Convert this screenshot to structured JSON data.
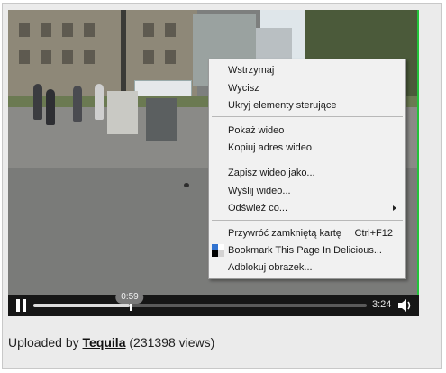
{
  "video": {
    "current_time": "0:59",
    "duration": "3:24",
    "progress_fraction": 0.29
  },
  "caption": {
    "prefix": "Uploaded by ",
    "user": "Tequila",
    "views": " (231398 views)"
  },
  "context_menu": {
    "items": [
      {
        "label": "Wstrzymaj"
      },
      {
        "label": "Wycisz"
      },
      {
        "label": "Ukryj elementy sterujące"
      },
      {
        "label": "Pokaż wideo"
      },
      {
        "label": "Kopiuj adres wideo"
      },
      {
        "label": "Zapisz wideo jako..."
      },
      {
        "label": "Wyślij wideo..."
      },
      {
        "label": "Odśwież co...",
        "submenu": true
      },
      {
        "label": "Przywróć zamkniętą kartę",
        "shortcut": "Ctrl+F12"
      },
      {
        "label": "Bookmark This Page In Delicious...",
        "icon": "delicious-icon"
      },
      {
        "label": "Adblokuj obrazek..."
      }
    ]
  },
  "colors": {
    "accent_green": "#22c23a",
    "delicious_blue": "#3274d1",
    "delicious_black": "#000000",
    "delicious_gray": "#d3d2d2"
  },
  "icons": [
    "pause-icon",
    "volume-icon",
    "delicious-icon",
    "submenu-arrow-icon"
  ]
}
